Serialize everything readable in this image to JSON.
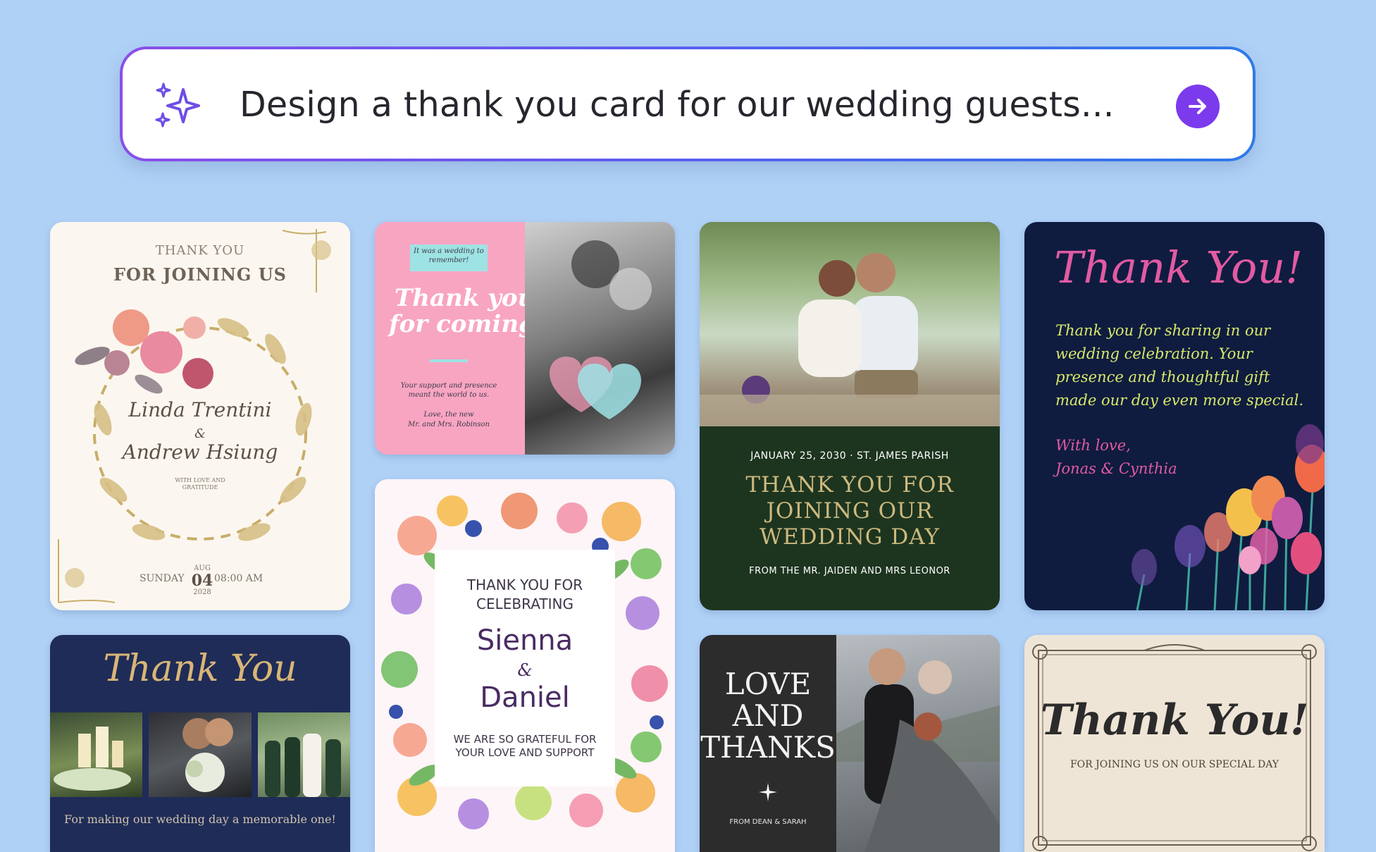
{
  "prompt": {
    "text": "Design a thank you card for our wedding guests...",
    "sparkle_icon": "sparkle-icon",
    "submit_icon": "arrow-right-icon",
    "accent": "#7c3aed"
  },
  "cards": {
    "floral_wreath": {
      "line1": "THANK YOU",
      "line2": "FOR JOINING US",
      "name1": "Linda Trentini",
      "amp": "&",
      "name2": "Andrew Hsiung",
      "sub": "WITH LOVE AND GRATITUDE",
      "day": "SUNDAY",
      "month": "AUG",
      "date": "04",
      "time": "08:00 AM",
      "year": "2028"
    },
    "pink_coming": {
      "tag": "It was a wedding to remember!",
      "title_line1": "Thank you",
      "title_line2": "for coming!",
      "support": "Your support and presence meant the world to us.",
      "signoff_line1": "Love, the new",
      "signoff_line2": "Mr. and Mrs. Robinson"
    },
    "green_parish": {
      "date_place": "JANUARY 25, 2030 · ST. JAMES PARISH",
      "title_line1": "THANK YOU FOR",
      "title_line2": "JOINING OUR",
      "title_line3": "WEDDING DAY",
      "from": "FROM THE MR. JAIDEN AND MRS LEONOR"
    },
    "navy_tulips": {
      "title": "Thank You!",
      "body_line1": "Thank you for sharing in our",
      "body_line2": "wedding celebration. Your",
      "body_line3": "presence and thoughtful gift",
      "body_line4": "made our day even more special.",
      "signoff_line1": "With love,",
      "signoff_line2": "Jonas & Cynthia"
    },
    "navy_collage": {
      "title": "Thank You",
      "caption": "For making our wedding day a memorable one!"
    },
    "watercolor_frame": {
      "line1": "THANK YOU FOR",
      "line2": "CELEBRATING",
      "name1": "Sienna",
      "amp": "&",
      "name2": "Daniel",
      "sub_line1": "WE ARE SO GRATEFUL FOR",
      "sub_line2": "YOUR LOVE AND SUPPORT"
    },
    "love_thanks": {
      "line1": "LOVE",
      "line2": "AND",
      "line3": "THANKS",
      "from": "FROM DEAN & SARAH"
    },
    "parchment": {
      "title": "Thank You!",
      "sub": "FOR JOINING US ON OUR SPECIAL DAY"
    }
  }
}
